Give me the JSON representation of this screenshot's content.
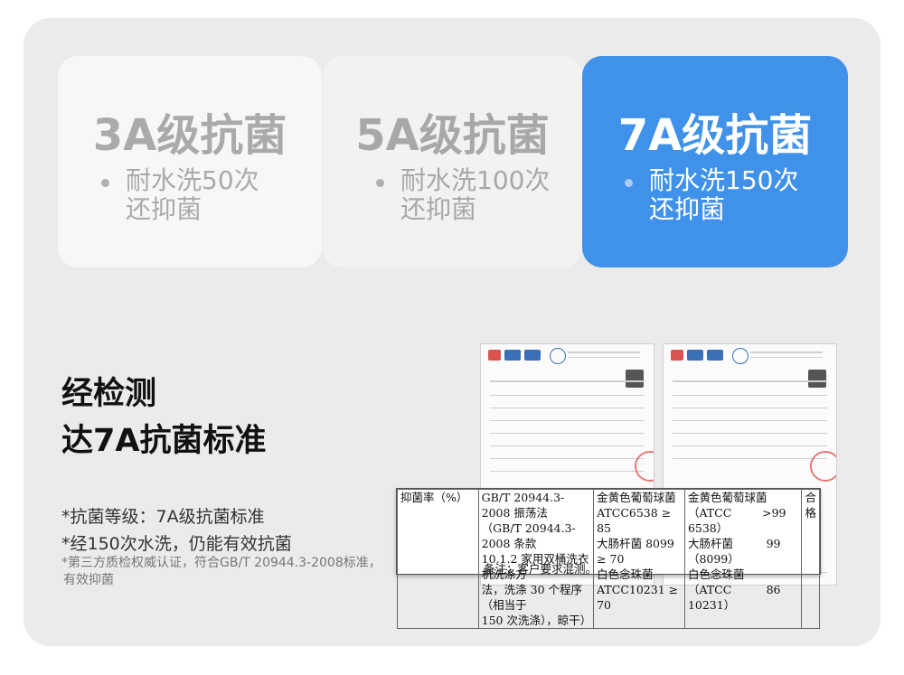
{
  "cards": [
    {
      "title": "3A级抗菌",
      "line1": "耐水洗50次",
      "line2": "还抑菌"
    },
    {
      "title": "5A级抗菌",
      "line1": "耐水洗100次",
      "line2": "还抑菌"
    },
    {
      "title": "7A级抗菌",
      "line1": "耐水洗150次",
      "line2": "还抑菌"
    }
  ],
  "headline": {
    "line1": "经检测",
    "line2": "达7A抗菌标准"
  },
  "notes": {
    "note1": "*抗菌等级：7A级抗菌标准",
    "note2": "*经150次水洗，仍能有效抗菌",
    "small1": "*第三方质检权威认证，符合GB/T 20944.3-2008标准，",
    "small2": "有效抑菌"
  },
  "report": {
    "label": "抑菌率（%）",
    "method": [
      "GB/T 20944.3-2008 振荡法",
      "（GB/T 20944.3-2008 条款",
      "10.1.2 家用双桶洗衣机洗涤方",
      "法，洗涤 30 个程序（相当于",
      "150 次洗涤），晾干）"
    ],
    "requirement": [
      "金黄色葡萄球菌",
      "ATCC6538 ≥ 85",
      "大肠杆菌 8099 ≥ 70",
      "白色念珠菌",
      "ATCC10231 ≥ 70"
    ],
    "result_names": [
      "金黄色葡萄球菌",
      "（ATCC 6538）",
      "大肠杆菌（8099）",
      "白色念珠菌",
      "（ATCC 10231）"
    ],
    "result_values": [
      "",
      ">99",
      "99",
      "",
      "86"
    ],
    "verdict": "合格",
    "remark": "备注：客户要求混测。"
  },
  "colors": {
    "accent": "#3f91ea",
    "panel": "#ebebeb"
  }
}
